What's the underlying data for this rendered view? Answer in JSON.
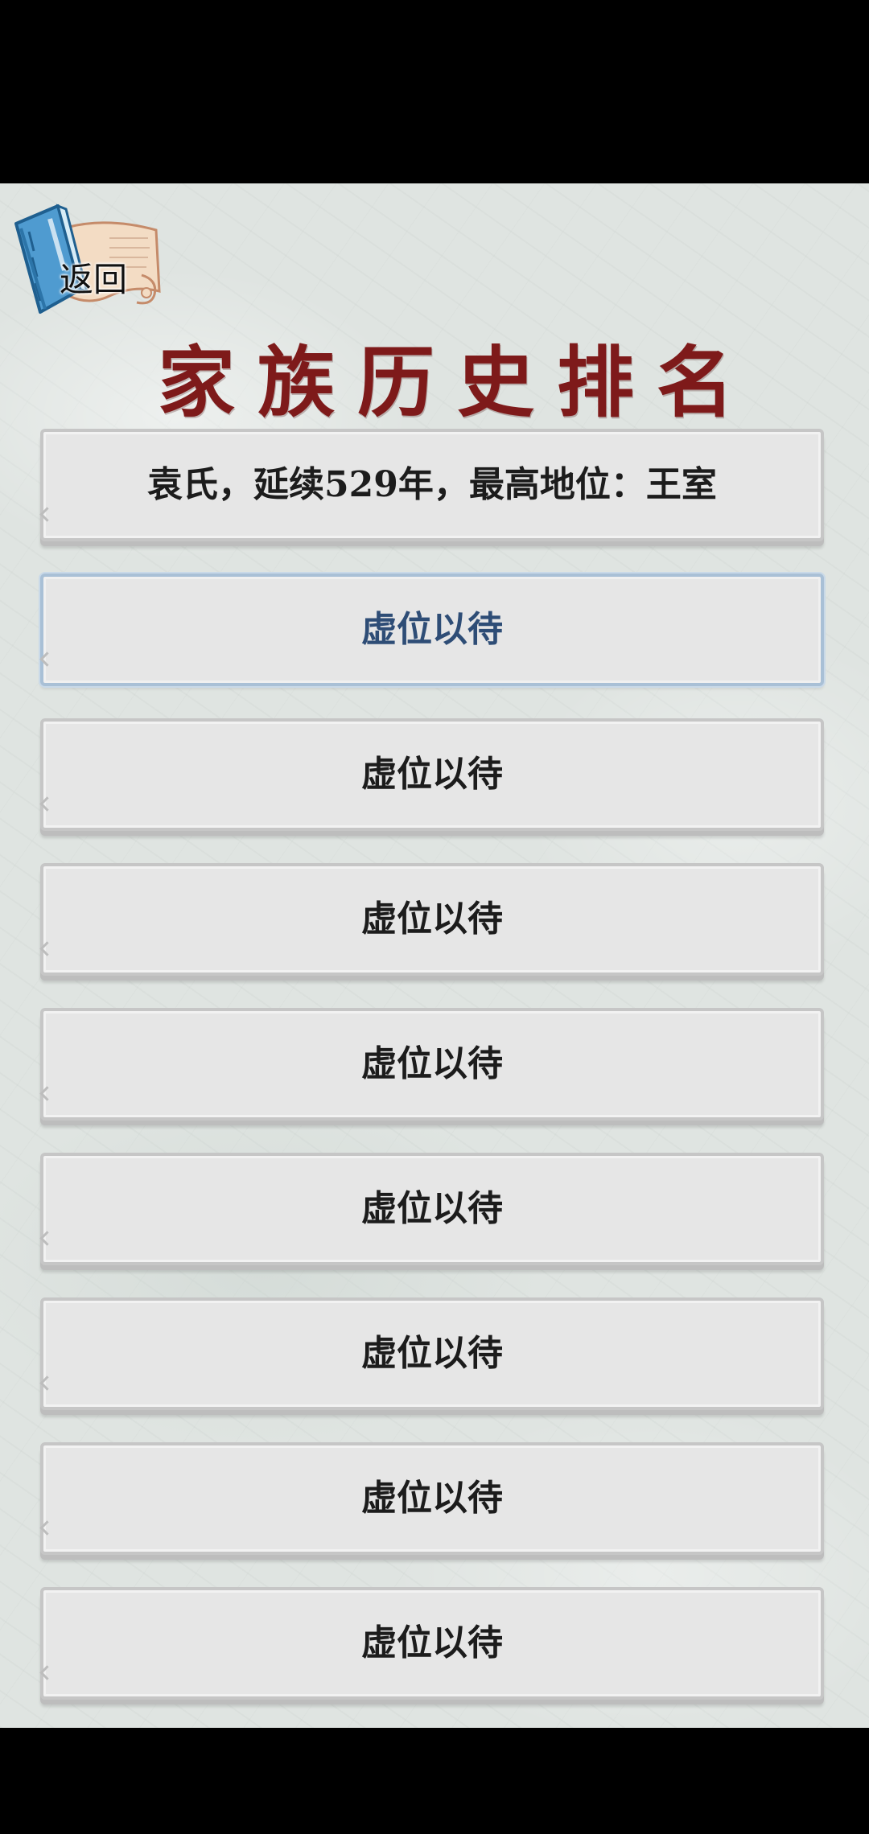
{
  "header": {
    "back_label": "返回",
    "title": "家族历史排名"
  },
  "rankings": [
    {
      "text": "袁氏，延续529年，最高地位：王室",
      "selected": false
    },
    {
      "text": "虚位以待",
      "selected": true
    },
    {
      "text": "虚位以待",
      "selected": false
    },
    {
      "text": "虚位以待",
      "selected": false
    },
    {
      "text": "虚位以待",
      "selected": false
    },
    {
      "text": "虚位以待",
      "selected": false
    },
    {
      "text": "虚位以待",
      "selected": false
    },
    {
      "text": "虚位以待",
      "selected": false
    },
    {
      "text": "虚位以待",
      "selected": false
    }
  ],
  "colors": {
    "title": "#7e1a1a",
    "selected_text": "#2e4d76",
    "item_text": "#1c1c1c",
    "panel": "#e6e6e6"
  }
}
